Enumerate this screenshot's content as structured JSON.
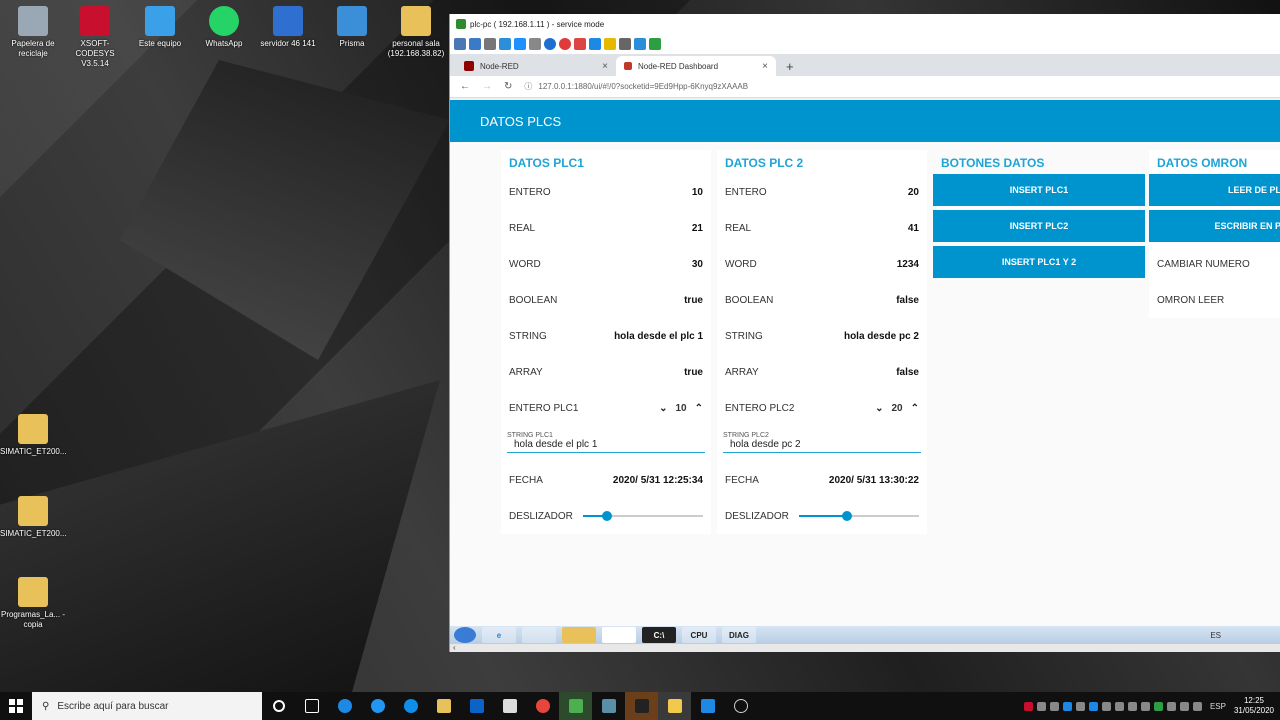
{
  "desktop": {
    "icons": [
      {
        "label": "Papelera de reciclaje",
        "icon": "recycle-bin-icon",
        "color": "#9aa7b5"
      },
      {
        "label": "XSOFT-CODESYS V3.5.14",
        "icon": "codesys-icon",
        "color": "#c8102e"
      },
      {
        "label": "Este equipo",
        "icon": "computer-icon",
        "color": "#3aa0e8"
      },
      {
        "label": "WhatsApp",
        "icon": "whatsapp-icon",
        "color": "#25d366"
      },
      {
        "label": "servidor 46 141",
        "icon": "remote-desktop-icon",
        "color": "#2f6fd0"
      },
      {
        "label": "Prisma",
        "icon": "prisma-icon",
        "color": "#3a8fd8"
      },
      {
        "label": "personal sala (192.168.38.82)",
        "icon": "folder-icon",
        "color": "#e8c15a"
      },
      {
        "label": "SIMATIC_ET200...",
        "icon": "folder-icon",
        "color": "#e8c15a"
      },
      {
        "label": "SIMATIC_ET200...",
        "icon": "folder-icon",
        "color": "#e8c15a"
      },
      {
        "label": "Programas_La... - copia",
        "icon": "folder-icon",
        "color": "#e8c15a"
      }
    ]
  },
  "window": {
    "title": "plc-pc ( 192.168.1.11 ) - service mode"
  },
  "browser": {
    "tabs": [
      {
        "label": "Node-RED",
        "close": "×"
      },
      {
        "label": "Node-RED Dashboard",
        "close": "×"
      }
    ],
    "new_tab": "+",
    "url": "127.0.0.1:1880/ui/#!/0?socketid=9Ed9Hpp-6Knyq9zXAAAB"
  },
  "dashboard": {
    "header": "DATOS PLCS",
    "plc1": {
      "title": "DATOS PLC1",
      "rows": [
        {
          "label": "ENTERO",
          "value": "10"
        },
        {
          "label": "REAL",
          "value": "21"
        },
        {
          "label": "WORD",
          "value": "30"
        },
        {
          "label": "BOOLEAN",
          "value": "true"
        },
        {
          "label": "STRING",
          "value": "hola desde el plc 1"
        },
        {
          "label": "ARRAY",
          "value": "true"
        }
      ],
      "numeric": {
        "label": "ENTERO PLC1",
        "value": "10"
      },
      "text_input": {
        "label": "STRING PLC1",
        "value": "hola desde el plc 1"
      },
      "date": {
        "label": "FECHA",
        "value": "2020/ 5/31 12:25:34"
      },
      "slider": {
        "label": "DESLIZADOR",
        "level": 0.2
      }
    },
    "plc2": {
      "title": "DATOS PLC 2",
      "rows": [
        {
          "label": "ENTERO",
          "value": "20"
        },
        {
          "label": "REAL",
          "value": "41"
        },
        {
          "label": "WORD",
          "value": "1234"
        },
        {
          "label": "BOOLEAN",
          "value": "false"
        },
        {
          "label": "STRING",
          "value": "hola desde pc 2"
        },
        {
          "label": "ARRAY",
          "value": "false"
        }
      ],
      "numeric": {
        "label": "ENTERO PLC2",
        "value": "20"
      },
      "text_input": {
        "label": "STRING PLC2",
        "value": "hola desde pc 2"
      },
      "date": {
        "label": "FECHA",
        "value": "2020/ 5/31 13:30:22"
      },
      "slider": {
        "label": "DESLIZADOR",
        "level": 0.4
      }
    },
    "buttons_group": {
      "title": "BOTONES DATOS",
      "buttons": [
        "INSERT PLC1",
        "INSERT PLC2",
        "INSERT PLC1 Y 2"
      ]
    },
    "omron_group": {
      "title": "DATOS OMRON",
      "buttons": [
        "LEER DE PL",
        "ESCRIBIR EN P"
      ],
      "rows": [
        "CAMBIAR NUMERO",
        "OMRON LEER"
      ]
    }
  },
  "inner_taskbar": {
    "items": [
      "CPU",
      "DIAG"
    ],
    "lang": "ES"
  },
  "taskbar": {
    "search_placeholder": "Escribe aquí para buscar",
    "lang": "ESP",
    "time": "12:25",
    "date": "31/05/2020"
  },
  "colors": {
    "accent": "#0094ce",
    "group_title": "#1fa4d6"
  }
}
